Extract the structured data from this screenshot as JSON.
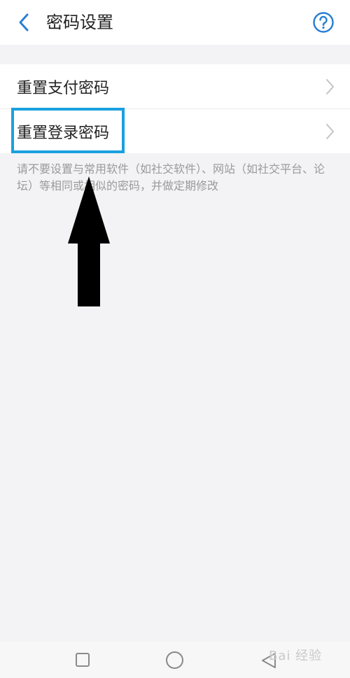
{
  "header": {
    "back_icon": "chevron-left-icon",
    "title": "密码设置",
    "help_icon": "question-circle-icon"
  },
  "settings": {
    "items": [
      {
        "label": "重置支付密码",
        "icon": "chevron-right-icon"
      },
      {
        "label": "重置登录密码",
        "icon": "chevron-right-icon"
      }
    ],
    "hint": "请不要设置与常用软件（如社交软件）、网站（如社交平台、论坛）等相同或相似的密码，并做定期修改"
  },
  "annotation": {
    "highlight_color": "#1aa0e0",
    "arrow_color": "#000000",
    "arrow_direction": "up"
  },
  "navbar": {
    "recent_icon": "square-icon",
    "home_icon": "circle-icon",
    "back_icon": "triangle-back-icon"
  },
  "watermark": {
    "text": "Bai 经验"
  },
  "colors": {
    "accent": "#2a7fd4",
    "background": "#f3f3f5",
    "surface": "#ffffff"
  }
}
